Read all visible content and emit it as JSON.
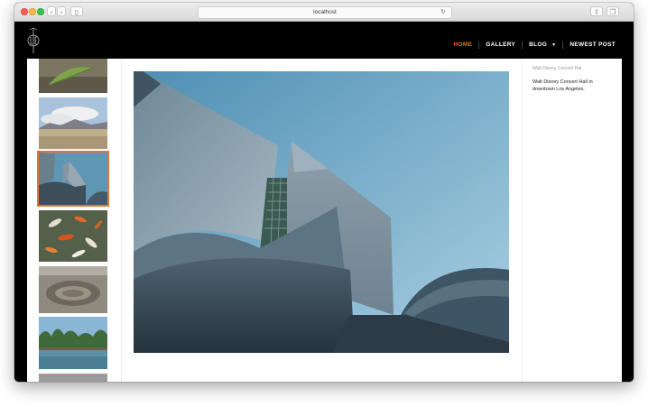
{
  "browser": {
    "url": "localhost"
  },
  "nav": {
    "items": [
      {
        "label": "HOME",
        "active": true
      },
      {
        "label": "GALLERY",
        "active": false
      },
      {
        "label": "BLOG",
        "active": false
      },
      {
        "label": "NEWEST POST",
        "active": false
      }
    ]
  },
  "photo": {
    "caption_small": "Walt Disney Concert Hal",
    "description": "Walt Disney Concert Hall in downtown Los Angeles."
  },
  "colors": {
    "accent": "#f06a2a",
    "header_bg": "#000000"
  },
  "icons": {
    "logo": "monogram-logo-icon",
    "reload": "reload-icon",
    "share": "share-icon",
    "tabs": "tabs-icon",
    "sidebar": "sidebar-icon"
  }
}
